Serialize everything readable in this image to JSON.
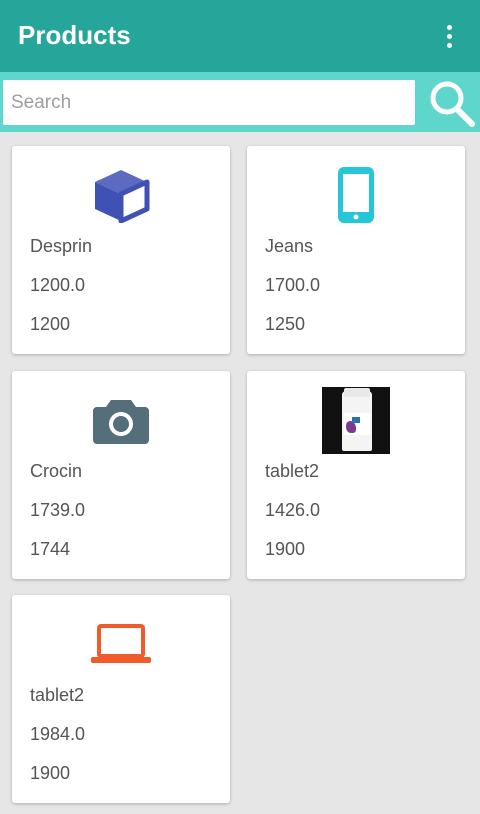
{
  "appbar": {
    "title": "Products",
    "menu_icon": "more-vert-icon"
  },
  "search": {
    "placeholder": "Search",
    "value": "",
    "icon": "search-icon"
  },
  "colors": {
    "primary": "#26a69a",
    "search_bar": "#5ed6cc",
    "background": "#e6e6e6",
    "box_icon": "#3f51b5",
    "phone_icon": "#26c6da",
    "camera_icon": "#546e7a",
    "laptop_icon": "#ef5b2b"
  },
  "products": [
    {
      "icon": "box-icon",
      "name": "Desprin",
      "price": "1200.0",
      "qty": "1200"
    },
    {
      "icon": "smartphone-icon",
      "name": "Jeans",
      "price": "1700.0",
      "qty": "1250"
    },
    {
      "icon": "camera-icon",
      "name": "Crocin",
      "price": "1739.0",
      "qty": "1744"
    },
    {
      "icon": "product-photo",
      "name": "tablet2",
      "price": "1426.0",
      "qty": "1900"
    },
    {
      "icon": "laptop-icon",
      "name": "tablet2",
      "price": "1984.0",
      "qty": "1900"
    }
  ]
}
